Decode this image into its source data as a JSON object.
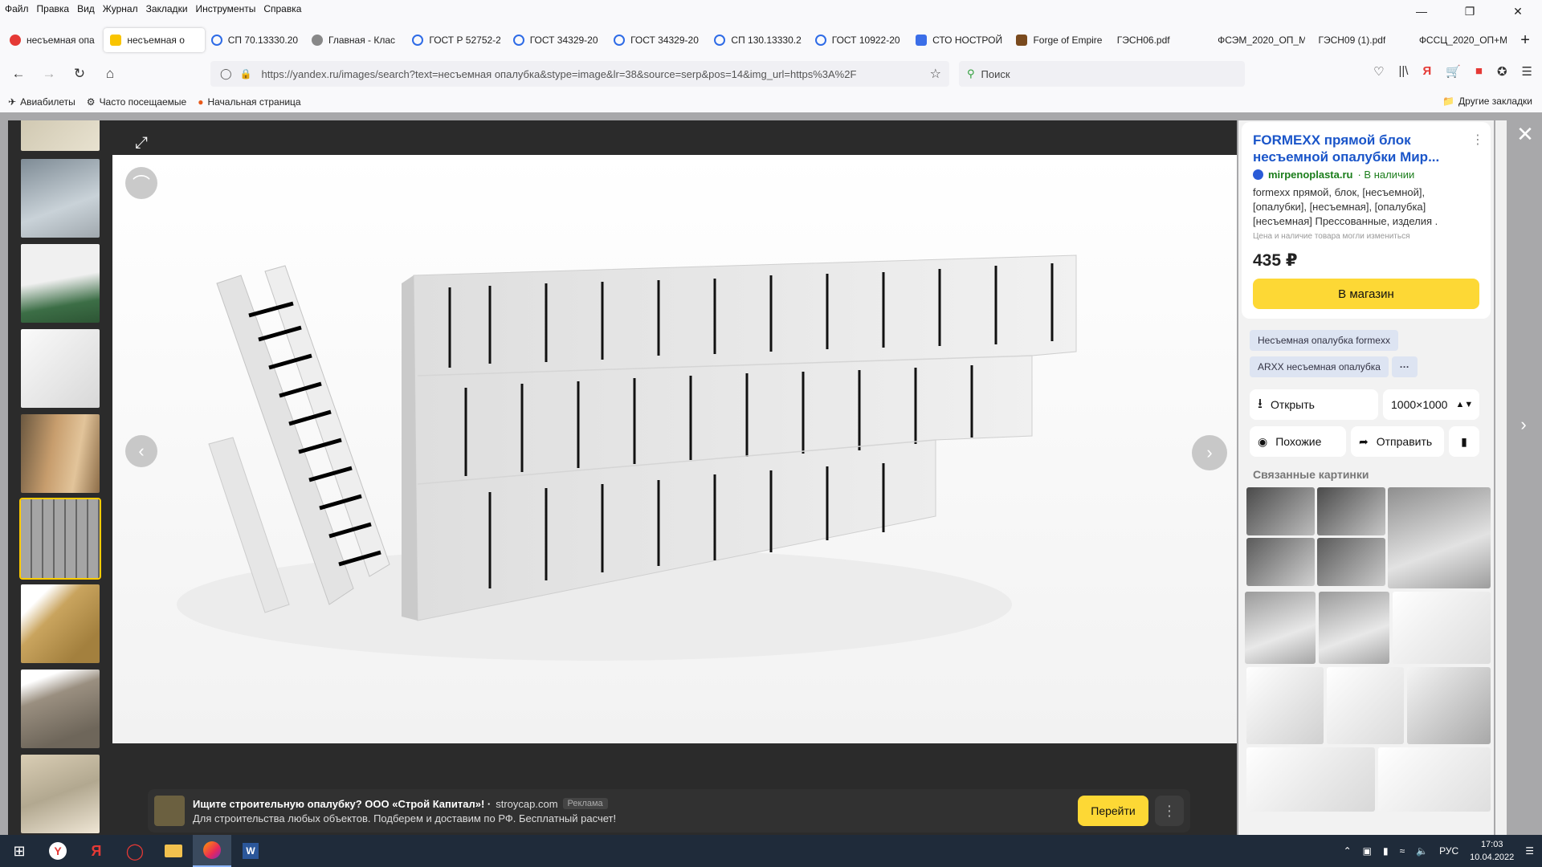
{
  "menu": [
    "Файл",
    "Правка",
    "Вид",
    "Журнал",
    "Закладки",
    "Инструменты",
    "Справка"
  ],
  "tabs": [
    {
      "label": "несъемная опа",
      "color": "#e53935",
      "active": false
    },
    {
      "label": "несъемная о",
      "color": "#f9c400",
      "active": true
    },
    {
      "label": "СП 70.13330.20",
      "color": "#2e6be6",
      "active": false
    },
    {
      "label": "Главная - Клас",
      "color": "#777777",
      "active": false
    },
    {
      "label": "ГОСТ Р 52752-2",
      "color": "#2e6be6",
      "active": false
    },
    {
      "label": "ГОСТ 34329-20",
      "color": "#2e6be6",
      "active": false
    },
    {
      "label": "ГОСТ 34329-20",
      "color": "#2e6be6",
      "active": false
    },
    {
      "label": "СП 130.13330.2",
      "color": "#2e6be6",
      "active": false
    },
    {
      "label": "ГОСТ 10922-20",
      "color": "#2e6be6",
      "active": false
    },
    {
      "label": "СТО НОСТРОЙ",
      "color": "#3b6ee8",
      "active": false
    },
    {
      "label": "Forge of Empire",
      "color": "#7a4a1e",
      "active": false
    },
    {
      "label": "ГЭСН06.pdf",
      "color": "#ffffff",
      "active": false
    },
    {
      "label": "ФСЭМ_2020_ОП_М",
      "color": "#ffffff",
      "active": false
    },
    {
      "label": "ГЭСН09 (1).pdf",
      "color": "#ffffff",
      "active": false
    },
    {
      "label": "ФССЦ_2020_ОП+М",
      "color": "#ffffff",
      "active": false
    }
  ],
  "url": "https://yandex.ru/images/search?text=несъемная опалубка&stype=image&lr=38&source=serp&pos=14&img_url=https%3A%2F",
  "search_placeholder": "Поиск",
  "bookmarks": [
    "Авиабилеты",
    "Часто посещаемые",
    "Начальная страница"
  ],
  "other_bookmarks": "Другие закладки",
  "product": {
    "title": "FORMEXX прямой блок несъемной опалубки Мир...",
    "site": "mirpenoplasta.ru",
    "stock": "· В наличии",
    "description": "formexx прямой, блок, [несъемной], [опалубки], [несъемная], [опалубка] [несъемная] Прессованные, изделия .",
    "note": "Цена и наличие товара могли измениться",
    "price": "435 ₽",
    "shop_button": "В магазин"
  },
  "chips": [
    "Несъемная опалубка formexx",
    "ARXX несъемная опалубка"
  ],
  "actions": {
    "open": "Открыть",
    "size": "1000×1000",
    "similar": "Похожие",
    "share": "Отправить"
  },
  "related_title": "Связанные картинки",
  "ad": {
    "title": "Ищите строительную опалубку? ООО «Строй Капитал»! ·",
    "domain": "stroycap.com",
    "label": "Реклама",
    "text": "Для строительства любых объектов. Подберем и доставим по РФ. Бесплатный расчет!",
    "button": "Перейти"
  },
  "tray": {
    "lang": "РУС",
    "time": "17:03",
    "date": "10.04.2022"
  }
}
